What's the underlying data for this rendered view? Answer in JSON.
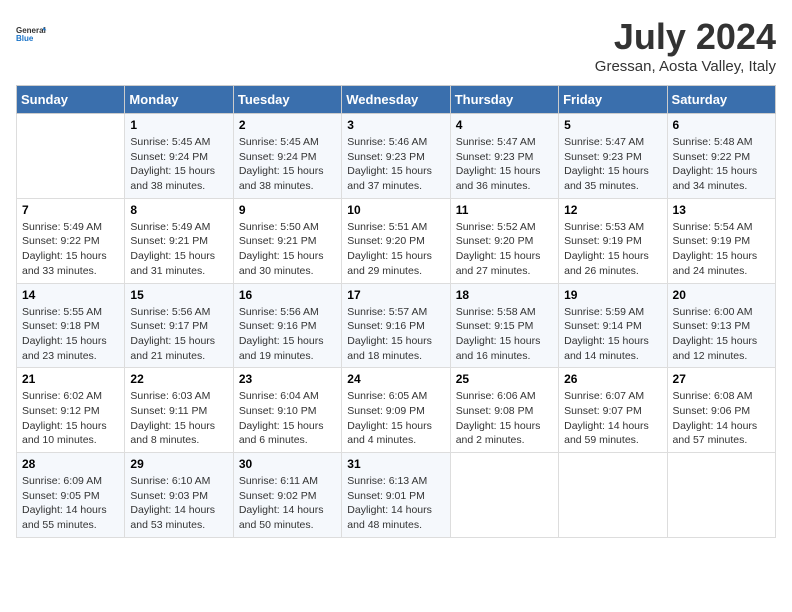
{
  "logo": {
    "line1": "General",
    "line2": "Blue"
  },
  "title": "July 2024",
  "location": "Gressan, Aosta Valley, Italy",
  "weekdays": [
    "Sunday",
    "Monday",
    "Tuesday",
    "Wednesday",
    "Thursday",
    "Friday",
    "Saturday"
  ],
  "weeks": [
    [
      {
        "day": "",
        "sunrise": "",
        "sunset": "",
        "daylight": ""
      },
      {
        "day": "1",
        "sunrise": "Sunrise: 5:45 AM",
        "sunset": "Sunset: 9:24 PM",
        "daylight": "Daylight: 15 hours and 38 minutes."
      },
      {
        "day": "2",
        "sunrise": "Sunrise: 5:45 AM",
        "sunset": "Sunset: 9:24 PM",
        "daylight": "Daylight: 15 hours and 38 minutes."
      },
      {
        "day": "3",
        "sunrise": "Sunrise: 5:46 AM",
        "sunset": "Sunset: 9:23 PM",
        "daylight": "Daylight: 15 hours and 37 minutes."
      },
      {
        "day": "4",
        "sunrise": "Sunrise: 5:47 AM",
        "sunset": "Sunset: 9:23 PM",
        "daylight": "Daylight: 15 hours and 36 minutes."
      },
      {
        "day": "5",
        "sunrise": "Sunrise: 5:47 AM",
        "sunset": "Sunset: 9:23 PM",
        "daylight": "Daylight: 15 hours and 35 minutes."
      },
      {
        "day": "6",
        "sunrise": "Sunrise: 5:48 AM",
        "sunset": "Sunset: 9:22 PM",
        "daylight": "Daylight: 15 hours and 34 minutes."
      }
    ],
    [
      {
        "day": "7",
        "sunrise": "Sunrise: 5:49 AM",
        "sunset": "Sunset: 9:22 PM",
        "daylight": "Daylight: 15 hours and 33 minutes."
      },
      {
        "day": "8",
        "sunrise": "Sunrise: 5:49 AM",
        "sunset": "Sunset: 9:21 PM",
        "daylight": "Daylight: 15 hours and 31 minutes."
      },
      {
        "day": "9",
        "sunrise": "Sunrise: 5:50 AM",
        "sunset": "Sunset: 9:21 PM",
        "daylight": "Daylight: 15 hours and 30 minutes."
      },
      {
        "day": "10",
        "sunrise": "Sunrise: 5:51 AM",
        "sunset": "Sunset: 9:20 PM",
        "daylight": "Daylight: 15 hours and 29 minutes."
      },
      {
        "day": "11",
        "sunrise": "Sunrise: 5:52 AM",
        "sunset": "Sunset: 9:20 PM",
        "daylight": "Daylight: 15 hours and 27 minutes."
      },
      {
        "day": "12",
        "sunrise": "Sunrise: 5:53 AM",
        "sunset": "Sunset: 9:19 PM",
        "daylight": "Daylight: 15 hours and 26 minutes."
      },
      {
        "day": "13",
        "sunrise": "Sunrise: 5:54 AM",
        "sunset": "Sunset: 9:19 PM",
        "daylight": "Daylight: 15 hours and 24 minutes."
      }
    ],
    [
      {
        "day": "14",
        "sunrise": "Sunrise: 5:55 AM",
        "sunset": "Sunset: 9:18 PM",
        "daylight": "Daylight: 15 hours and 23 minutes."
      },
      {
        "day": "15",
        "sunrise": "Sunrise: 5:56 AM",
        "sunset": "Sunset: 9:17 PM",
        "daylight": "Daylight: 15 hours and 21 minutes."
      },
      {
        "day": "16",
        "sunrise": "Sunrise: 5:56 AM",
        "sunset": "Sunset: 9:16 PM",
        "daylight": "Daylight: 15 hours and 19 minutes."
      },
      {
        "day": "17",
        "sunrise": "Sunrise: 5:57 AM",
        "sunset": "Sunset: 9:16 PM",
        "daylight": "Daylight: 15 hours and 18 minutes."
      },
      {
        "day": "18",
        "sunrise": "Sunrise: 5:58 AM",
        "sunset": "Sunset: 9:15 PM",
        "daylight": "Daylight: 15 hours and 16 minutes."
      },
      {
        "day": "19",
        "sunrise": "Sunrise: 5:59 AM",
        "sunset": "Sunset: 9:14 PM",
        "daylight": "Daylight: 15 hours and 14 minutes."
      },
      {
        "day": "20",
        "sunrise": "Sunrise: 6:00 AM",
        "sunset": "Sunset: 9:13 PM",
        "daylight": "Daylight: 15 hours and 12 minutes."
      }
    ],
    [
      {
        "day": "21",
        "sunrise": "Sunrise: 6:02 AM",
        "sunset": "Sunset: 9:12 PM",
        "daylight": "Daylight: 15 hours and 10 minutes."
      },
      {
        "day": "22",
        "sunrise": "Sunrise: 6:03 AM",
        "sunset": "Sunset: 9:11 PM",
        "daylight": "Daylight: 15 hours and 8 minutes."
      },
      {
        "day": "23",
        "sunrise": "Sunrise: 6:04 AM",
        "sunset": "Sunset: 9:10 PM",
        "daylight": "Daylight: 15 hours and 6 minutes."
      },
      {
        "day": "24",
        "sunrise": "Sunrise: 6:05 AM",
        "sunset": "Sunset: 9:09 PM",
        "daylight": "Daylight: 15 hours and 4 minutes."
      },
      {
        "day": "25",
        "sunrise": "Sunrise: 6:06 AM",
        "sunset": "Sunset: 9:08 PM",
        "daylight": "Daylight: 15 hours and 2 minutes."
      },
      {
        "day": "26",
        "sunrise": "Sunrise: 6:07 AM",
        "sunset": "Sunset: 9:07 PM",
        "daylight": "Daylight: 14 hours and 59 minutes."
      },
      {
        "day": "27",
        "sunrise": "Sunrise: 6:08 AM",
        "sunset": "Sunset: 9:06 PM",
        "daylight": "Daylight: 14 hours and 57 minutes."
      }
    ],
    [
      {
        "day": "28",
        "sunrise": "Sunrise: 6:09 AM",
        "sunset": "Sunset: 9:05 PM",
        "daylight": "Daylight: 14 hours and 55 minutes."
      },
      {
        "day": "29",
        "sunrise": "Sunrise: 6:10 AM",
        "sunset": "Sunset: 9:03 PM",
        "daylight": "Daylight: 14 hours and 53 minutes."
      },
      {
        "day": "30",
        "sunrise": "Sunrise: 6:11 AM",
        "sunset": "Sunset: 9:02 PM",
        "daylight": "Daylight: 14 hours and 50 minutes."
      },
      {
        "day": "31",
        "sunrise": "Sunrise: 6:13 AM",
        "sunset": "Sunset: 9:01 PM",
        "daylight": "Daylight: 14 hours and 48 minutes."
      },
      {
        "day": "",
        "sunrise": "",
        "sunset": "",
        "daylight": ""
      },
      {
        "day": "",
        "sunrise": "",
        "sunset": "",
        "daylight": ""
      },
      {
        "day": "",
        "sunrise": "",
        "sunset": "",
        "daylight": ""
      }
    ]
  ]
}
